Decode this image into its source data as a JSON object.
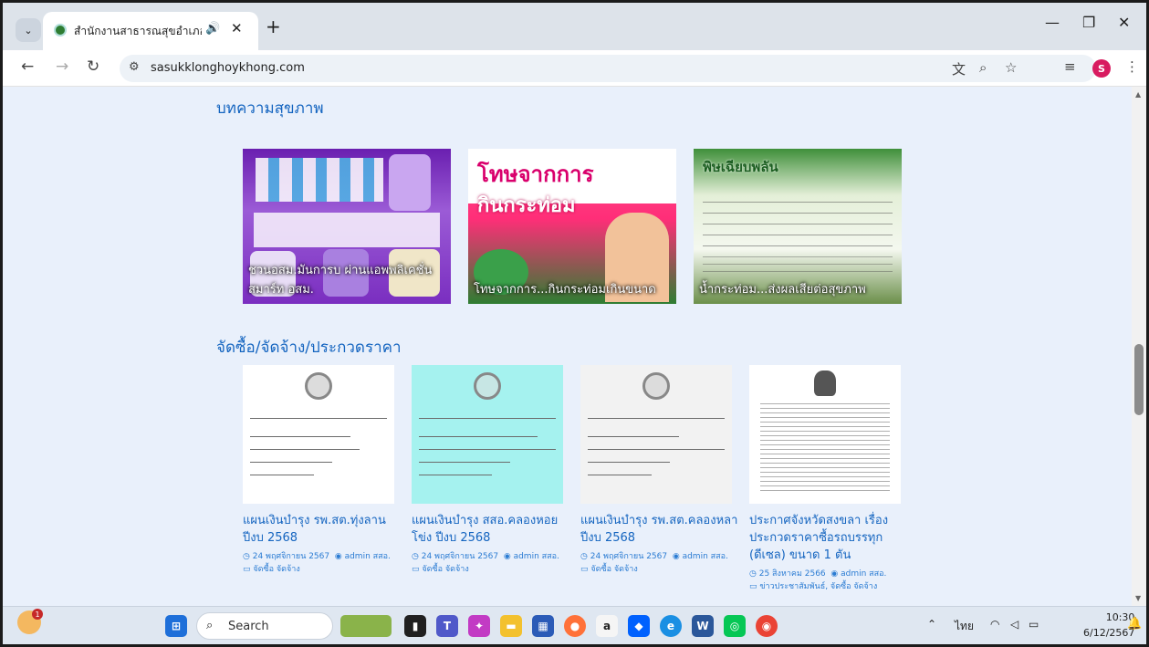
{
  "browser": {
    "tab_title": "สำนักงานสาธารณสุขอำเภอคลอ",
    "tab_audio_icon": "speaker-icon",
    "tab_close": "✕",
    "new_tab": "+",
    "tab_search": "⌄",
    "url": "sasukklonghoykhong.com",
    "profile_initial": "S",
    "window_minimize": "—",
    "window_restore": "❐",
    "window_close": "✕"
  },
  "page": {
    "section_health_title": "บทความสุขภาพ",
    "articles": [
      {
        "caption": "ชวนอสม.มันการบ ผ่านแอพพลิเคชั่น สมาร์ท อสม."
      },
      {
        "heading": "โทษจากการ",
        "subheading": "กินกระท่อม",
        "caption": "โทษจากการ...กินกระท่อมเกินขนาด"
      },
      {
        "heading": "พิษเฉียบพลัน",
        "caption": "น้ำกระท่อม...ส่งผลเสียต่อสุขภาพ"
      }
    ],
    "section_procure_title": "จัดซื้อ/จัดจ้าง/ประกวดราคา",
    "procurements": [
      {
        "title": "แผนเงินบำรุง รพ.สต.ทุ่งลาน ปีงบ 2568",
        "date": "24 พฤศจิกายน 2567",
        "author": "admin สสอ.",
        "category": "จัดซื้อ จัดจ้าง"
      },
      {
        "title": "แผนเงินบำรุง สสอ.คลองหอยโข่ง ปีงบ 2568",
        "date": "24 พฤศจิกายน 2567",
        "author": "admin สสอ.",
        "category": "จัดซื้อ จัดจ้าง"
      },
      {
        "title": "แผนเงินบำรุง รพ.สต.คลองหลา ปีงบ 2568",
        "date": "24 พฤศจิกายน 2567",
        "author": "admin สสอ.",
        "category": "จัดซื้อ จัดจ้าง"
      },
      {
        "title": "ประกาศจังหวัดสงขลา เรื่อง ประกวดราคาซื้อรถบรรทุก (ดีเซล) ขนาด 1 ตัน",
        "date": "25 สิงหาคม 2566",
        "author": "admin สสอ.",
        "category": "ข่าวประชาสัมพันธ์, จัดซื้อ จัดจ้าง"
      }
    ]
  },
  "taskbar": {
    "search_label": "Search",
    "notification_count": "1",
    "language": "ไทย",
    "time": "10:30",
    "date": "6/12/2567"
  }
}
